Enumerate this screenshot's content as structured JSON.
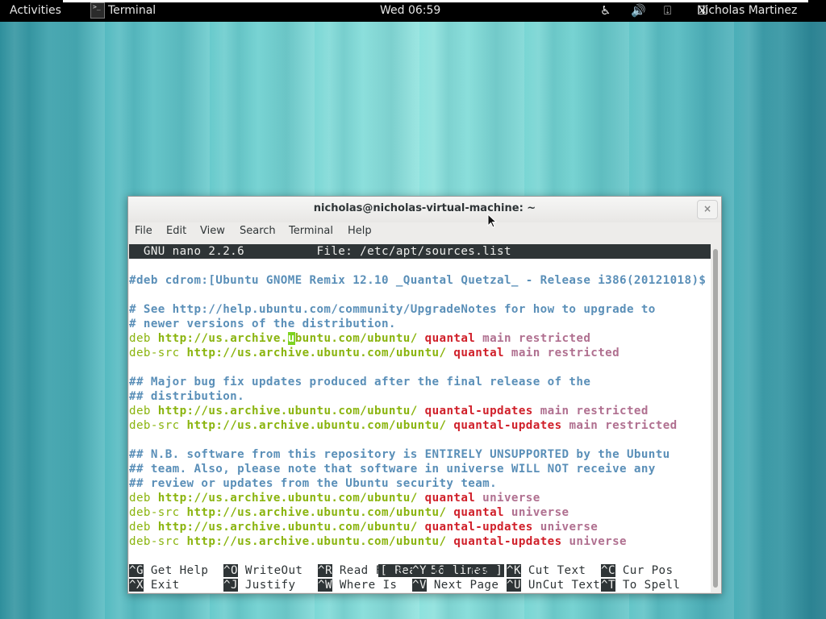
{
  "topbar": {
    "activities": "Activities",
    "app_name": "Terminal",
    "clock": "Wed 06:59",
    "user": "Nicholas Martinez",
    "icons": [
      "accessibility-icon",
      "volume-icon",
      "network-icon",
      "user-status-icon"
    ]
  },
  "window": {
    "title": "nicholas@nicholas-virtual-machine: ~",
    "close": "×",
    "menu": [
      "File",
      "Edit",
      "View",
      "Search",
      "Terminal",
      "Help"
    ]
  },
  "nano": {
    "header": "  GNU nano 2.2.6          File: /etc/apt/sources.list",
    "status": "[ Read 56 lines ]",
    "lines": [
      {
        "type": "comment",
        "text": "#deb cdrom:[Ubuntu GNOME Remix 12.10 _Quantal Quetzal_ - Release i386(20121018)$"
      },
      {
        "type": "blank",
        "text": ""
      },
      {
        "type": "comment",
        "text": "# See http://help.ubuntu.com/community/UpgradeNotes for how to upgrade to"
      },
      {
        "type": "comment",
        "text": "# newer versions of the distribution."
      },
      {
        "type": "entry",
        "kw": "deb",
        "url": "http://us.archive.ubuntu.com/ubuntu/",
        "dist": "quantal",
        "comp": "main restricted",
        "cursor": true
      },
      {
        "type": "entry",
        "kw": "deb-src",
        "url": "http://us.archive.ubuntu.com/ubuntu/",
        "dist": "quantal",
        "comp": "main restricted"
      },
      {
        "type": "blank",
        "text": ""
      },
      {
        "type": "comment",
        "text": "## Major bug fix updates produced after the final release of the"
      },
      {
        "type": "comment",
        "text": "## distribution."
      },
      {
        "type": "entry",
        "kw": "deb",
        "url": "http://us.archive.ubuntu.com/ubuntu/",
        "dist": "quantal-updates",
        "comp": "main restricted"
      },
      {
        "type": "entry",
        "kw": "deb-src",
        "url": "http://us.archive.ubuntu.com/ubuntu/",
        "dist": "quantal-updates",
        "comp": "main restricted"
      },
      {
        "type": "blank",
        "text": ""
      },
      {
        "type": "comment",
        "text": "## N.B. software from this repository is ENTIRELY UNSUPPORTED by the Ubuntu"
      },
      {
        "type": "comment",
        "text": "## team. Also, please note that software in universe WILL NOT receive any"
      },
      {
        "type": "comment",
        "text": "## review or updates from the Ubuntu security team."
      },
      {
        "type": "entry",
        "kw": "deb",
        "url": "http://us.archive.ubuntu.com/ubuntu/",
        "dist": "quantal",
        "comp": "universe"
      },
      {
        "type": "entry",
        "kw": "deb-src",
        "url": "http://us.archive.ubuntu.com/ubuntu/",
        "dist": "quantal",
        "comp": "universe"
      },
      {
        "type": "entry",
        "kw": "deb",
        "url": "http://us.archive.ubuntu.com/ubuntu/",
        "dist": "quantal-updates",
        "comp": "universe"
      },
      {
        "type": "entry",
        "kw": "deb-src",
        "url": "http://us.archive.ubuntu.com/ubuntu/",
        "dist": "quantal-updates",
        "comp": "universe"
      }
    ],
    "shortcuts": [
      [
        {
          "key": "^G",
          "label": "Get Help"
        },
        {
          "key": "^O",
          "label": "WriteOut"
        },
        {
          "key": "^R",
          "label": "Read File"
        },
        {
          "key": "^Y",
          "label": "Prev Page"
        },
        {
          "key": "^K",
          "label": "Cut Text"
        },
        {
          "key": "^C",
          "label": "Cur Pos"
        }
      ],
      [
        {
          "key": "^X",
          "label": "Exit"
        },
        {
          "key": "^J",
          "label": "Justify"
        },
        {
          "key": "^W",
          "label": "Where Is"
        },
        {
          "key": "^V",
          "label": "Next Page"
        },
        {
          "key": "^U",
          "label": "UnCut Text"
        },
        {
          "key": "^T",
          "label": "To Spell"
        }
      ]
    ]
  },
  "colors": {
    "comment": "#5a8fb8",
    "deb": "#8ab40e",
    "dist": "#d0202a",
    "component": "#b07090",
    "header_bg": "#2e3436",
    "cursor": "#7ed321"
  }
}
